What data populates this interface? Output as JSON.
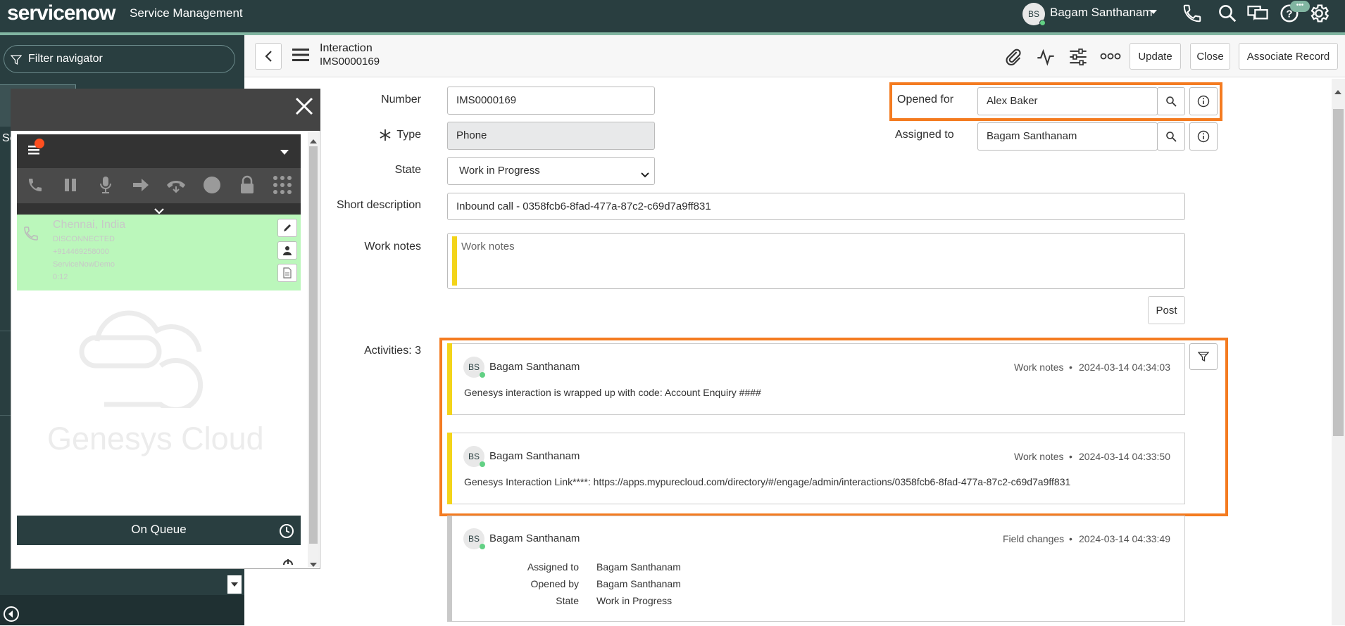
{
  "header": {
    "logo": "servicenow",
    "app_title": "Service Management",
    "user_initials": "BS",
    "user_name": "Bagam Santhanam",
    "chat_badge": "•••"
  },
  "navigator": {
    "filter_placeholder": "Filter navigator",
    "partial_item": "Se"
  },
  "form_header": {
    "title": "Interaction",
    "subtitle": "IMS0000169",
    "update_label": "Update",
    "close_label": "Close",
    "associate_label": "Associate Record"
  },
  "form": {
    "number_label": "Number",
    "number_value": "IMS0000169",
    "type_label": "Type",
    "type_value": "Phone",
    "state_label": "State",
    "state_value": "Work in Progress",
    "short_desc_label": "Short description",
    "short_desc_value": "Inbound call - 0358fcb6-8fad-477a-87c2-c69d7a9ff831",
    "work_notes_label": "Work notes",
    "work_notes_placeholder": "Work notes",
    "opened_for_label": "Opened for",
    "opened_for_value": "Alex Baker",
    "assigned_to_label": "Assigned to",
    "assigned_to_value": "Bagam Santhanam",
    "post_label": "Post",
    "activities_label": "Activities: 3"
  },
  "activities": [
    {
      "initials": "BS",
      "name": "Bagam Santhanam",
      "type": "Work notes",
      "time": "2024-03-14 04:34:03",
      "text": "Genesys interaction is wrapped up with code: Account Enquiry ####"
    },
    {
      "initials": "BS",
      "name": "Bagam Santhanam",
      "type": "Work notes",
      "time": "2024-03-14 04:33:50",
      "text": "Genesys Interaction Link****: https://apps.mypurecloud.com/directory/#/engage/admin/interactions/0358fcb6-8fad-477a-87c2-c69d7a9ff831"
    },
    {
      "initials": "BS",
      "name": "Bagam Santhanam",
      "type": "Field changes",
      "time": "2024-03-14 04:33:49",
      "changes": [
        {
          "field": "Assigned to",
          "value": "Bagam Santhanam"
        },
        {
          "field": "Opened by",
          "value": "Bagam Santhanam"
        },
        {
          "field": "State",
          "value": "Work in Progress"
        }
      ]
    }
  ],
  "softphone": {
    "location": "Chennai, India",
    "status": "DISCONNECTED",
    "number": "+914469258000",
    "account": "ServiceNowDemo",
    "duration": "0:12",
    "watermark": "Genesys Cloud",
    "queue_label": "On Queue"
  },
  "colors": {
    "banner": "#293e40",
    "accent_line": "#81b5a1",
    "highlight": "#f47b20",
    "work_note_bar": "#f3d41a",
    "call_card": "#bbf7bb",
    "presence": "#62d084"
  }
}
